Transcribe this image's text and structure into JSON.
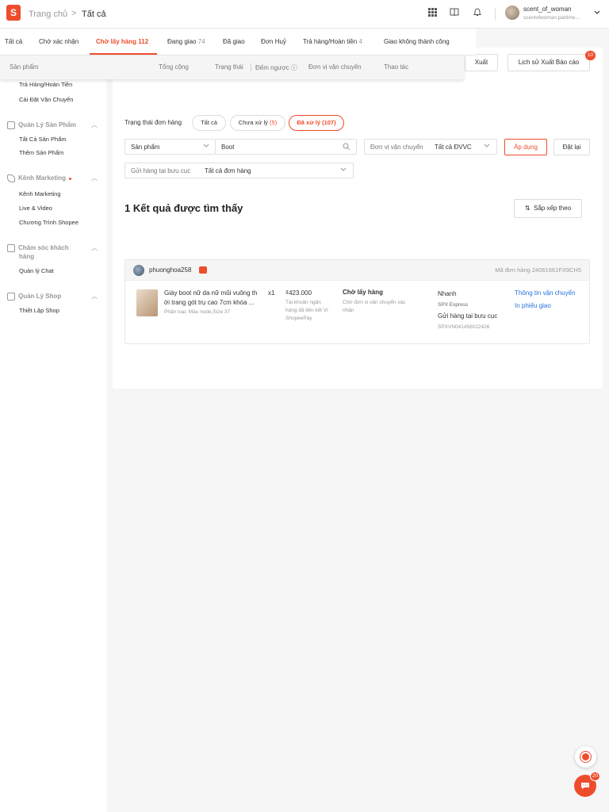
{
  "header": {
    "logo_letter": "S",
    "breadcrumb_home": "Trang chủ",
    "breadcrumb_sep": ">",
    "breadcrumb_current": "Tất cả",
    "user_name": "scent_of_woman",
    "user_sub": "scentofwoman:partime..."
  },
  "tabs": [
    {
      "label": "Tất cả",
      "count": ""
    },
    {
      "label": "Chờ xác nhận",
      "count": ""
    },
    {
      "label": "Chờ lấy hàng",
      "count": "112"
    },
    {
      "label": "Đang giao",
      "count": "74"
    },
    {
      "label": "Đã giao",
      "count": ""
    },
    {
      "label": "Đơn Huỷ",
      "count": ""
    },
    {
      "label": "Trả hàng/Hoàn tiền",
      "count": "4"
    },
    {
      "label": "Giao không thành công",
      "count": ""
    }
  ],
  "table_header": {
    "product": "Sản phẩm",
    "total": "Tổng cộng",
    "status": "Trạng thái",
    "countdown": "Đếm ngược",
    "carrier": "Đơn vị vận chuyển",
    "actions": "Thao tác"
  },
  "sidebar": {
    "order_items": [
      "Trả Hàng/Hoàn Tiền",
      "Cài Đặt Vận Chuyển"
    ],
    "groups": [
      {
        "title": "Quản Lý Sản Phẩm",
        "items": [
          "Tất Cả Sản Phẩm",
          "Thêm Sản Phẩm"
        ]
      },
      {
        "title": "Kênh Marketing",
        "items": [
          "Kênh Marketing",
          "Live & Video",
          "Chương Trình Shopee"
        ]
      },
      {
        "title": "Chăm sóc khách",
        "title2": "hàng",
        "items": [
          "Quản lý Chat"
        ]
      },
      {
        "title": "Quản Lý Shop",
        "items": [
          "Thiết Lập Shop"
        ]
      }
    ]
  },
  "toolbar": {
    "export": "Xuất",
    "export_history": "Lịch sử Xuất Báo cáo",
    "export_badge": "10"
  },
  "filters": {
    "status_label": "Trạng thái đơn hàng",
    "pill_all": "Tất cả",
    "pill_pending": "Chưa xử lý",
    "pill_pending_count": "(5)",
    "pill_done": "Đã xử lý (107)",
    "search_field": "Sản phẩm",
    "search_value": "Boot",
    "carrier_label": "Đơn vị vận chuyển",
    "carrier_value": "Tất cả ĐVVC",
    "apply": "Áp dụng",
    "reset": "Đặt lại",
    "dropoff_label": "Gửi hàng tại bưu cục",
    "dropoff_value": "Tất cả đơn hàng"
  },
  "results": {
    "title": "1 Kết quả được tìm thấy",
    "sort": "Sắp xếp theo"
  },
  "order": {
    "buyer": "phuonghoa258",
    "order_id": "Mã đơn hàng 24061661FX9CH5",
    "product_name_1": "Giày boot nữ da nữ mũi vuông th",
    "product_name_2": "ời trang gót trụ cao 7cm khóa ...",
    "quantity": "x1",
    "variant": "Phân loại: Màu nude,Size 37",
    "price": "₫423.000",
    "payment_1": "Tài khoản ngân",
    "payment_2": "hàng đã liên kết Ví",
    "payment_3": "ShopeePay",
    "status": "Chờ lấy hàng",
    "status_desc_1": "Chờ đơn vị vận chuyển xác",
    "status_desc_2": "nhận",
    "ship_speed": "Nhanh",
    "ship_carrier": "SPX Express",
    "ship_method": "Gửi hàng tại bưu cục",
    "tracking": "SPXVN041456022426",
    "action_ship_info": "Thông tin vận chuyển",
    "action_print": "In phiếu giao"
  },
  "float": {
    "chat_badge": "20"
  },
  "colors": {
    "accent": "#ee4d2d",
    "link": "#2673dd"
  }
}
